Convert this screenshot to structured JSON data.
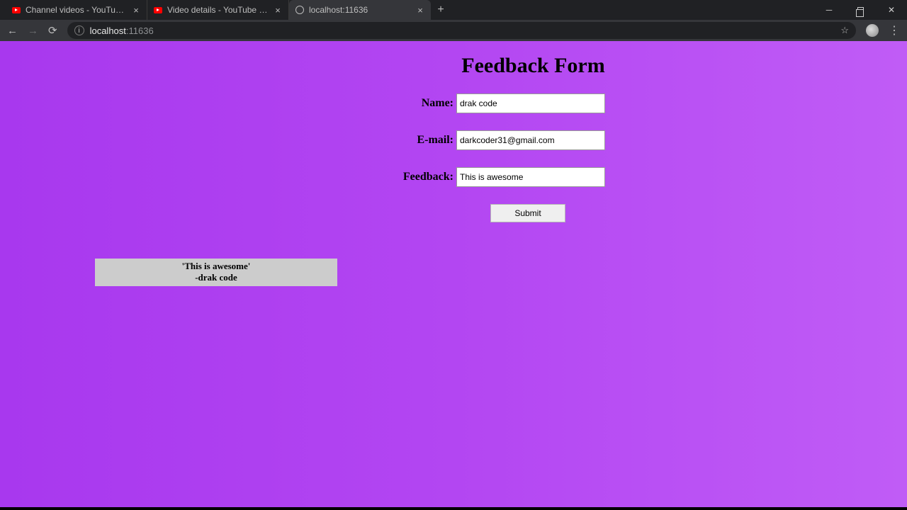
{
  "browser": {
    "tabs": [
      {
        "title": "Channel videos - YouTube Studio"
      },
      {
        "title": "Video details - YouTube Studio"
      },
      {
        "title": "localhost:11636"
      }
    ],
    "url_host": "localhost",
    "url_port": ":11636"
  },
  "page": {
    "heading": "Feedback Form",
    "fields": {
      "name_label": "Name:",
      "name_value": "drak code",
      "email_label": "E-mail:",
      "email_value": "darkcoder31@gmail.com",
      "feedback_label": "Feedback:",
      "feedback_value": "This is awesome"
    },
    "submit_label": "Submit",
    "card": {
      "quote": "'This is awesome'",
      "author": "-drak code"
    }
  }
}
